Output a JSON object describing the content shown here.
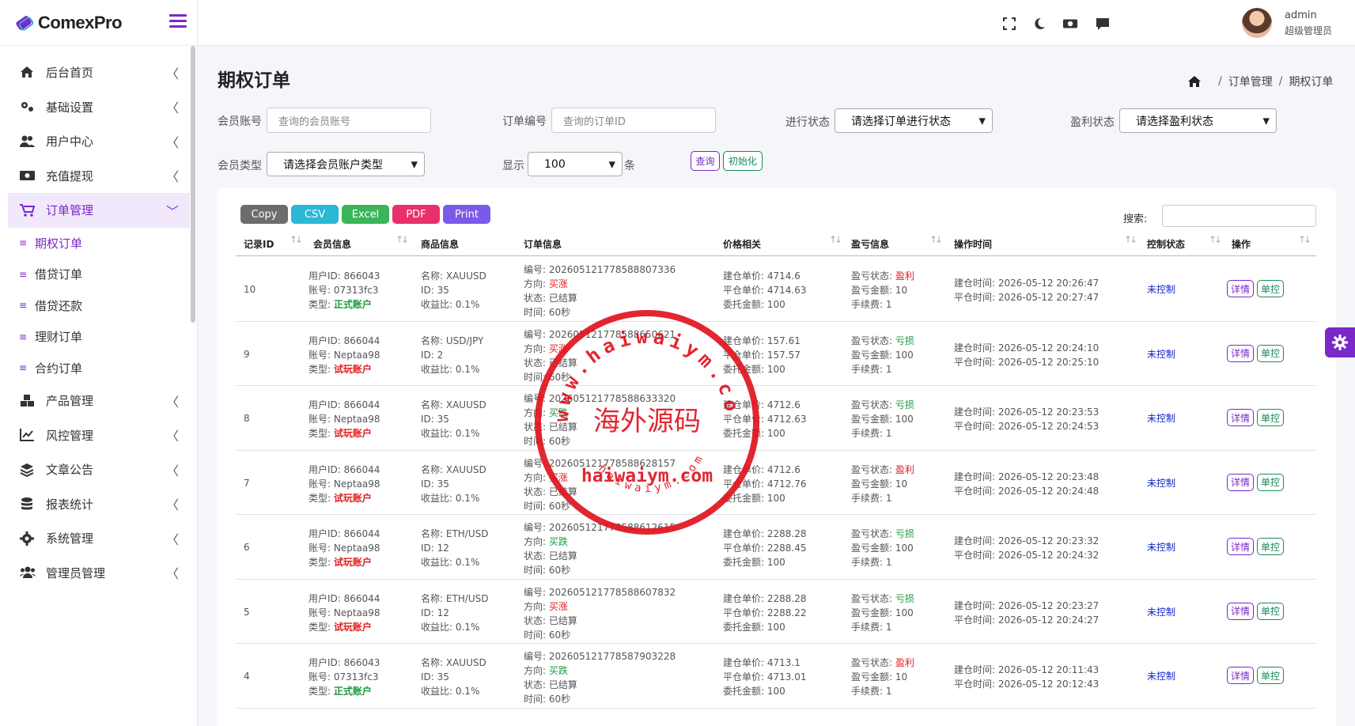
{
  "app": {
    "logo_text": "ComexPro"
  },
  "colors": {
    "accent": "#7a28c8",
    "profit_red": "#e02020",
    "loss_green": "#1a9a3a",
    "stamp_red": "#e0141e"
  },
  "sidebar": {
    "items": [
      {
        "label": "后台首页",
        "icon": "home-icon"
      },
      {
        "label": "基础设置",
        "icon": "cogs-icon"
      },
      {
        "label": "用户中心",
        "icon": "users-icon"
      },
      {
        "label": "充值提现",
        "icon": "money-icon"
      },
      {
        "label": "订单管理",
        "icon": "cart-icon",
        "expanded": true
      },
      {
        "label": "产品管理",
        "icon": "cubes-icon"
      },
      {
        "label": "风控管理",
        "icon": "chart-line-icon"
      },
      {
        "label": "文章公告",
        "icon": "layers-icon"
      },
      {
        "label": "报表统计",
        "icon": "coins-icon"
      },
      {
        "label": "系统管理",
        "icon": "gear-icon"
      },
      {
        "label": "管理员管理",
        "icon": "user-group-icon"
      }
    ],
    "sub_items": [
      "期权订单",
      "借贷订单",
      "借贷还款",
      "理财订单",
      "合约订单"
    ],
    "current_sub": "期权订单"
  },
  "topbar": {
    "user_name": "admin",
    "user_role": "超级管理员"
  },
  "page": {
    "title": "期权订单",
    "breadcrumb": [
      "订单管理",
      "期权订单"
    ]
  },
  "filters": {
    "member_label": "会员账号",
    "member_placeholder": "查询的会员账号",
    "order_label": "订单编号",
    "order_placeholder": "查询的订单ID",
    "progress_label": "进行状态",
    "progress_select": "请选择订单进行状态",
    "profit_label": "盈利状态",
    "profit_select": "请选择盈利状态",
    "type_label": "会员类型",
    "type_select": "请选择会员账户类型",
    "show_label": "显示",
    "show_value": "100",
    "show_suffix": "条",
    "query_button": "查询",
    "reset_button": "初始化"
  },
  "export": {
    "buttons": [
      "Copy",
      "CSV",
      "Excel",
      "PDF",
      "Print"
    ],
    "search_label": "搜索:"
  },
  "table": {
    "headers": [
      "记录ID",
      "会员信息",
      "商品信息",
      "订单信息",
      "价格相关",
      "盈亏信息",
      "操作时间",
      "控制状态",
      "操作"
    ],
    "rows": [
      {
        "id": "10",
        "uid": "用户ID: 866043",
        "acct": "账号: 07313fc3",
        "type_label": "类型:",
        "type": "正式账户",
        "real": true,
        "pname": "名称: XAUUSD",
        "pid": "ID: 35",
        "prate": "收益比: 0.1%",
        "ono": "编号: 202605121778588807336",
        "dir_label": "方向:",
        "dir": "买涨",
        "up": true,
        "ostate": "状态: 已结算",
        "otime": "时间: 60秒",
        "open_price": "建仓单价: 4714.6",
        "close_price": "平仓单价: 4714.63",
        "amount": "委托金额: 100",
        "pl_label": "盈亏状态:",
        "pl": "盈利",
        "profit": true,
        "pl_amount": "盈亏金额: 10",
        "fee": "手续费: 1",
        "open_time": "建仓时间: 2026-05-12 20:26:47",
        "close_time": "平仓时间: 2026-05-12 20:27:47",
        "control": "未控制",
        "btn_detail": "详情",
        "btn_control": "单控"
      },
      {
        "id": "9",
        "uid": "用户ID: 866044",
        "acct": "账号: Neptaa98",
        "type_label": "类型:",
        "type": "试玩账户",
        "real": false,
        "pname": "名称: USD/JPY",
        "pid": "ID: 2",
        "prate": "收益比: 0.1%",
        "ono": "编号: 202605121778588650621",
        "dir_label": "方向:",
        "dir": "买涨",
        "up": true,
        "ostate": "状态: 已结算",
        "otime": "时间: 60秒",
        "open_price": "建仓单价: 157.61",
        "close_price": "平仓单价: 157.57",
        "amount": "委托金额: 100",
        "pl_label": "盈亏状态:",
        "pl": "亏损",
        "profit": false,
        "pl_amount": "盈亏金额: 100",
        "fee": "手续费: 1",
        "open_time": "建仓时间: 2026-05-12 20:24:10",
        "close_time": "平仓时间: 2026-05-12 20:25:10",
        "control": "未控制",
        "btn_detail": "详情",
        "btn_control": "单控"
      },
      {
        "id": "8",
        "uid": "用户ID: 866044",
        "acct": "账号: Neptaa98",
        "type_label": "类型:",
        "type": "试玩账户",
        "real": false,
        "pname": "名称: XAUUSD",
        "pid": "ID: 35",
        "prate": "收益比: 0.1%",
        "ono": "编号: 202605121778588633320",
        "dir_label": "方向:",
        "dir": "买跌",
        "up": false,
        "ostate": "状态: 已结算",
        "otime": "时间: 60秒",
        "open_price": "建仓单价: 4712.6",
        "close_price": "平仓单价: 4712.63",
        "amount": "委托金额: 100",
        "pl_label": "盈亏状态:",
        "pl": "亏损",
        "profit": false,
        "pl_amount": "盈亏金额: 100",
        "fee": "手续费: 1",
        "open_time": "建仓时间: 2026-05-12 20:23:53",
        "close_time": "平仓时间: 2026-05-12 20:24:53",
        "control": "未控制",
        "btn_detail": "详情",
        "btn_control": "单控"
      },
      {
        "id": "7",
        "uid": "用户ID: 866044",
        "acct": "账号: Neptaa98",
        "type_label": "类型:",
        "type": "试玩账户",
        "real": false,
        "pname": "名称: XAUUSD",
        "pid": "ID: 35",
        "prate": "收益比: 0.1%",
        "ono": "编号: 202605121778588628157",
        "dir_label": "方向:",
        "dir": "买涨",
        "up": true,
        "ostate": "状态: 已结算",
        "otime": "时间: 60秒",
        "open_price": "建仓单价: 4712.6",
        "close_price": "平仓单价: 4712.76",
        "amount": "委托金额: 100",
        "pl_label": "盈亏状态:",
        "pl": "盈利",
        "profit": true,
        "pl_amount": "盈亏金额: 10",
        "fee": "手续费: 1",
        "open_time": "建仓时间: 2026-05-12 20:23:48",
        "close_time": "平仓时间: 2026-05-12 20:24:48",
        "control": "未控制",
        "btn_detail": "详情",
        "btn_control": "单控"
      },
      {
        "id": "6",
        "uid": "用户ID: 866044",
        "acct": "账号: Neptaa98",
        "type_label": "类型:",
        "type": "试玩账户",
        "real": false,
        "pname": "名称: ETH/USD",
        "pid": "ID: 12",
        "prate": "收益比: 0.1%",
        "ono": "编号: 202605121778588612615",
        "dir_label": "方向:",
        "dir": "买跌",
        "up": false,
        "ostate": "状态: 已结算",
        "otime": "时间: 60秒",
        "open_price": "建仓单价: 2288.28",
        "close_price": "平仓单价: 2288.45",
        "amount": "委托金额: 100",
        "pl_label": "盈亏状态:",
        "pl": "亏损",
        "profit": false,
        "pl_amount": "盈亏金额: 100",
        "fee": "手续费: 1",
        "open_time": "建仓时间: 2026-05-12 20:23:32",
        "close_time": "平仓时间: 2026-05-12 20:24:32",
        "control": "未控制",
        "btn_detail": "详情",
        "btn_control": "单控"
      },
      {
        "id": "5",
        "uid": "用户ID: 866044",
        "acct": "账号: Neptaa98",
        "type_label": "类型:",
        "type": "试玩账户",
        "real": false,
        "pname": "名称: ETH/USD",
        "pid": "ID: 12",
        "prate": "收益比: 0.1%",
        "ono": "编号: 202605121778588607832",
        "dir_label": "方向:",
        "dir": "买涨",
        "up": true,
        "ostate": "状态: 已结算",
        "otime": "时间: 60秒",
        "open_price": "建仓单价: 2288.28",
        "close_price": "平仓单价: 2288.22",
        "amount": "委托金额: 100",
        "pl_label": "盈亏状态:",
        "pl": "亏损",
        "profit": false,
        "pl_amount": "盈亏金额: 100",
        "fee": "手续费: 1",
        "open_time": "建仓时间: 2026-05-12 20:23:27",
        "close_time": "平仓时间: 2026-05-12 20:24:27",
        "control": "未控制",
        "btn_detail": "详情",
        "btn_control": "单控"
      },
      {
        "id": "4",
        "uid": "用户ID: 866043",
        "acct": "账号: 07313fc3",
        "type_label": "类型:",
        "type": "正式账户",
        "real": true,
        "pname": "名称: XAUUSD",
        "pid": "ID: 35",
        "prate": "收益比: 0.1%",
        "ono": "编号: 202605121778587903228",
        "dir_label": "方向:",
        "dir": "买跌",
        "up": false,
        "ostate": "状态: 已结算",
        "otime": "时间: 60秒",
        "open_price": "建仓单价: 4713.1",
        "close_price": "平仓单价: 4713.01",
        "amount": "委托金额: 100",
        "pl_label": "盈亏状态:",
        "pl": "盈利",
        "profit": true,
        "pl_amount": "盈亏金额: 10",
        "fee": "手续费: 1",
        "open_time": "建仓时间: 2026-05-12 20:11:43",
        "close_time": "平仓时间: 2026-05-12 20:12:43",
        "control": "未控制",
        "btn_detail": "详情",
        "btn_control": "单控"
      }
    ]
  },
  "watermark": {
    "center": "海外源码",
    "url": "haiwaiym.com",
    "ring": "www.haiwaiym.com"
  }
}
